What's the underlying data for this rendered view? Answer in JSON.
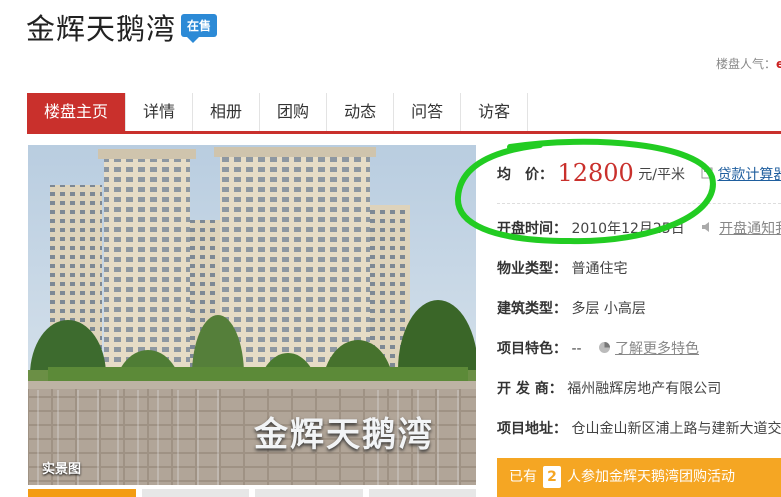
{
  "header": {
    "title": "金辉天鹅湾",
    "status_badge": "在售",
    "popularity_label": "楼盘人气：",
    "popularity_value": "e"
  },
  "nav": {
    "tabs": [
      {
        "label": "楼盘主页",
        "active": true
      },
      {
        "label": "详情"
      },
      {
        "label": "相册"
      },
      {
        "label": "团购"
      },
      {
        "label": "动态"
      },
      {
        "label": "问答"
      },
      {
        "label": "访客"
      }
    ]
  },
  "gallery": {
    "caption": "实景图",
    "sign_text": "金辉天鹅湾"
  },
  "info": {
    "price_label": "均　价：",
    "price_value": "12800",
    "price_unit": "元/平米",
    "loan_calc": "贷款计算器",
    "open_label": "开盘时间：",
    "open_value": "2010年12月25日",
    "open_notify": "开盘通知我",
    "property_label": "物业类型：",
    "property_value": "普通住宅",
    "building_label": "建筑类型：",
    "building_value": "多层 小高层",
    "feature_label": "项目特色：",
    "feature_value": "--",
    "feature_more": "了解更多特色",
    "developer_label": "开 发 商：",
    "developer_value": "福州融辉房地产有限公司",
    "address_label": "项目地址：",
    "address_value": "仓山金山新区浦上路与建新大道交汇"
  },
  "group_buy": {
    "prefix": "已有",
    "count": "2",
    "suffix": "人参加金辉天鹅湾团购活动"
  },
  "colors": {
    "accent_red": "#c9302c",
    "badge_blue": "#2c8ad6",
    "group_orange": "#f5a623",
    "annotation_green": "#22cc22"
  }
}
